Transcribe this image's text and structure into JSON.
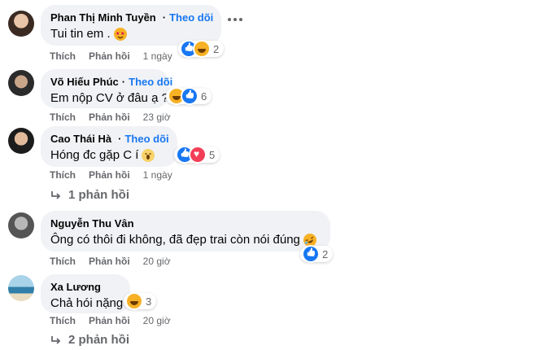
{
  "actions": {
    "like": "Thích",
    "reply": "Phản hồi"
  },
  "follow_label": "Theo dõi",
  "comments": [
    {
      "name": "Phan Thị Minh Tuyền",
      "verified": true,
      "text": "Tui tin em .",
      "emoji": "star-struck",
      "reactions": [
        "like",
        "haha"
      ],
      "count": "2",
      "time": "1 ngày"
    },
    {
      "name": "Võ Hiếu Phúc",
      "verified": false,
      "text": "Em nộp CV ở đâu ạ ?",
      "reactions": [
        "haha",
        "like"
      ],
      "count": "6",
      "time": "23 giờ"
    },
    {
      "name": "Cao Thái Hà",
      "verified": true,
      "text": "Hóng đc gặp C í",
      "emoji": "scream",
      "reactions": [
        "like",
        "love"
      ],
      "count": "5",
      "time": "1 ngày",
      "replies": "1 phản hồi"
    },
    {
      "name": "Nguyễn Thu Vân",
      "verified": false,
      "text": "Ông có thôi đi không, đã đẹp trai còn nói đúng",
      "emoji": "rolling-laugh",
      "reactions": [
        "like"
      ],
      "count": "2",
      "time": "20 giờ"
    },
    {
      "name": "Xa Lương",
      "verified": false,
      "text": "Chả hói nặng",
      "reactions": [
        "haha"
      ],
      "count": "3",
      "time": "20 giờ",
      "replies": "2 phản hồi"
    }
  ]
}
